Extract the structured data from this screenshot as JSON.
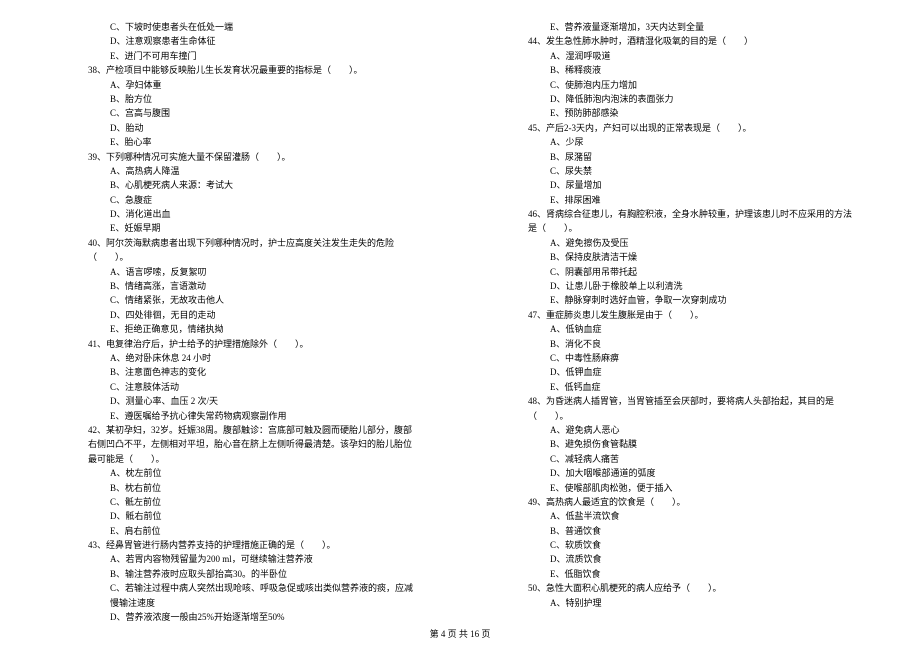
{
  "left_column": {
    "pre_options": [
      "C、下坡时使患者头在低处一端",
      "D、注意观察患者生命体征",
      "E、进门不可用车撞门"
    ],
    "questions": [
      {
        "num": "38、",
        "text": "产检项目中能够反映胎儿生长发育状况最重要的指标是（　　）。",
        "options": [
          "A、孕妇体重",
          "B、胎方位",
          "C、宫高与腹围",
          "D、胎动",
          "E、胎心率"
        ]
      },
      {
        "num": "39、",
        "text": "下列哪种情况可实施大量不保留灌肠（　　）。",
        "options": [
          "A、高热病人降温",
          "B、心肌梗死病人来源：考试大",
          "C、急腹症",
          "D、消化道出血",
          "E、妊娠早期"
        ]
      },
      {
        "num": "40、",
        "text": "阿尔茨海默病患者出现下列哪种情况时，护士应高度关注发生走失的危险（　　）。",
        "options": [
          "A、语言啰嗦，反复絮叨",
          "B、情绪高涨，言语激动",
          "C、情绪紧张，无故攻击他人",
          "D、四处徘徊，无目的走动",
          "E、拒绝正确意见，情绪执拗"
        ]
      },
      {
        "num": "41、",
        "text": "电复律治疗后，护士给予的护理措施除外（　　）。",
        "options": [
          "A、绝对卧床休息 24 小时",
          "B、注意面色神志的变化",
          "C、注意肢体活动",
          "D、测量心率、血压 2 次/天",
          "E、遵医嘱给予抗心律失常药物病观察副作用"
        ]
      },
      {
        "num": "42、",
        "text": "某初孕妇，32岁。妊娠38周。腹部触诊：宫底部可触及圆而硬胎儿部分，腹部右侧凹凸不平，左侧相对平坦，胎心音在脐上左侧听得最清楚。该孕妇的胎儿胎位最可能是（　　）。",
        "options": [
          "A、枕左前位",
          "B、枕右前位",
          "C、骶左前位",
          "D、骶右前位",
          "E、肩右前位"
        ]
      },
      {
        "num": "43、",
        "text": "经鼻胃管进行肠内营养支持的护理措施正确的是（　　）。",
        "options": [
          "A、若胃内容物残留量为200 ml，可继续输注营养液",
          "B、输注营养液时应取头部抬高30。的半卧位",
          "C、若输注过程中病人突然出现呛咳、呼吸急促或咳出类似营养液的痰，应减慢输注速度",
          "D、营养液浓度一般由25%开始逐渐增至50%"
        ]
      }
    ]
  },
  "right_column": {
    "pre_options": [
      "E、营养液量逐渐增加，3天内达到全量"
    ],
    "questions": [
      {
        "num": "44、",
        "text": "发生急性肺水肿时，酒精湿化吸氧的目的是（　　）",
        "options": [
          "A、湿润呼吸道",
          "B、稀释痰液",
          "C、使肺泡内压力增加",
          "D、降低肺泡内泡沫的表面张力",
          "E、预防肺部感染"
        ]
      },
      {
        "num": "45、",
        "text": "产后2-3天内，产妇可以出现的正常表现是（　　）。",
        "options": [
          "A、少尿",
          "B、尿潴留",
          "C、尿失禁",
          "D、尿量增加",
          "E、排尿困难"
        ]
      },
      {
        "num": "46、",
        "text": "肾病综合征患儿，有胸腔积液，全身水肿较重，护理该患儿时不应采用的方法是（　　）。",
        "options": [
          "A、避免擦伤及受压",
          "B、保持皮肤清洁干燥",
          "C、阴囊部用吊带托起",
          "D、让患儿卧于橡胶单上以利清洗",
          "E、静脉穿刺时选好血管，争取一次穿刺成功"
        ]
      },
      {
        "num": "47、",
        "text": "重症肺炎患儿发生腹胀是由于（　　）。",
        "options": [
          "A、低钠血症",
          "B、消化不良",
          "C、中毒性肠麻痹",
          "D、低钾血症",
          "E、低钙血症"
        ]
      },
      {
        "num": "48、",
        "text": "为昏迷病人插胃管，当胃管插至会厌部时，要将病人头部抬起，其目的是（　　）。",
        "options": [
          "A、避免病人恶心",
          "B、避免损伤食管黏膜",
          "C、减轻病人痛苦",
          "D、加大咽喉部通道的弧度",
          "E、使喉部肌肉松弛，便于插入"
        ]
      },
      {
        "num": "49、",
        "text": "高热病人最适宜的饮食是（　　）。",
        "options": [
          "A、低盐半流饮食",
          "B、普通饮食",
          "C、软质饮食",
          "D、流质饮食",
          "E、低脂饮食"
        ]
      },
      {
        "num": "50、",
        "text": "急性大面积心肌梗死的病人应给予（　　）。",
        "options": [
          "A、特别护理"
        ]
      }
    ]
  },
  "footer": "第 4 页 共 16 页"
}
